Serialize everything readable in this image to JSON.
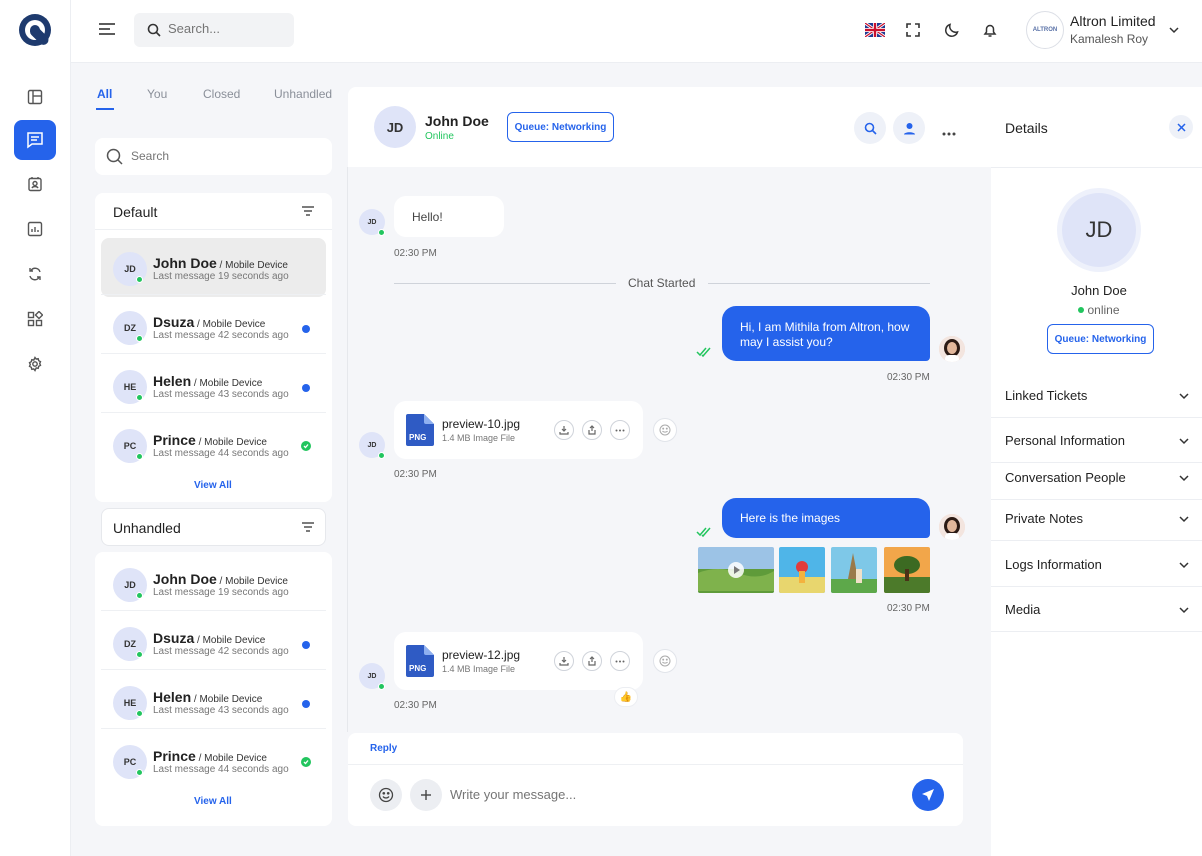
{
  "topbar": {
    "search_placeholder": "Search...",
    "company": "Altron Limited",
    "user": "Kamalesh Roy",
    "avatar_text": "ALTRON"
  },
  "sidebar": {
    "items": [
      {
        "icon": "layout-icon"
      },
      {
        "icon": "chat-icon",
        "active": true
      },
      {
        "icon": "contacts-icon"
      },
      {
        "icon": "report-icon"
      },
      {
        "icon": "sync-icon"
      },
      {
        "icon": "apps-icon"
      },
      {
        "icon": "gear-icon"
      }
    ]
  },
  "tabs": [
    "All",
    "You",
    "Closed",
    "Unhandled"
  ],
  "list_search_placeholder": "Search",
  "groups": [
    {
      "title": "Default",
      "view_all": "View All",
      "items": [
        {
          "initials": "JD",
          "name": "John Doe",
          "device": " / Mobile Device",
          "last": "Last message 19 seconds ago",
          "status": "selected"
        },
        {
          "initials": "DZ",
          "name": "Dsuza",
          "device": " / Mobile Device",
          "last": "Last message 42 seconds ago",
          "status": "unread"
        },
        {
          "initials": "HE",
          "name": "Helen",
          "device": " / Mobile Device",
          "last": "Last message 43 seconds ago",
          "status": "unread"
        },
        {
          "initials": "PC",
          "name": "Prince",
          "device": " / Mobile Device",
          "last": "Last message 44 seconds ago",
          "status": "read"
        }
      ]
    },
    {
      "title": "Unhandled",
      "view_all": "View All",
      "items": [
        {
          "initials": "JD",
          "name": "John Doe",
          "device": " / Mobile Device",
          "last": "Last message 19 seconds ago",
          "status": "none"
        },
        {
          "initials": "DZ",
          "name": "Dsuza",
          "device": " / Mobile Device",
          "last": "Last message 42 seconds ago",
          "status": "unread"
        },
        {
          "initials": "HE",
          "name": "Helen",
          "device": " / Mobile Device",
          "last": "Last message 43 seconds ago",
          "status": "unread"
        },
        {
          "initials": "PC",
          "name": "Prince",
          "device": " / Mobile Device",
          "last": "Last message 44 seconds ago",
          "status": "read"
        }
      ]
    }
  ],
  "chat": {
    "initials": "JD",
    "name": "John Doe",
    "status": "Online",
    "queue": "Queue: Networking",
    "chat_started": "Chat Started",
    "messages": {
      "m1": {
        "text": "Hello!",
        "time": "02:30 PM",
        "initials": "JD"
      },
      "m2": {
        "text": "Hi, I am Mithila from Altron, how may I assist you?",
        "time": "02:30 PM"
      },
      "m3": {
        "file": "preview-10.jpg",
        "meta": "1.4 MB Image File",
        "badge": "PNG",
        "time": "02:30 PM",
        "initials": "JD"
      },
      "m4": {
        "text": "Here is the images",
        "time": "02:30 PM"
      },
      "m5": {
        "file": "preview-12.jpg",
        "meta": "1.4 MB Image File",
        "badge": "PNG",
        "time": "02:30 PM",
        "initials": "JD",
        "reaction": "👍"
      }
    }
  },
  "composer": {
    "reply_label": "Reply",
    "placeholder": "Write your message..."
  },
  "details": {
    "title": "Details",
    "initials": "JD",
    "name": "John Doe",
    "status": "online",
    "queue": "Queue: Networking",
    "sections": [
      "Linked Tickets",
      "Personal Information",
      "Conversation People",
      "Private Notes",
      "Logs Information",
      "Media"
    ]
  },
  "colors": {
    "accent": "#2563eb",
    "online": "#22c55e"
  }
}
